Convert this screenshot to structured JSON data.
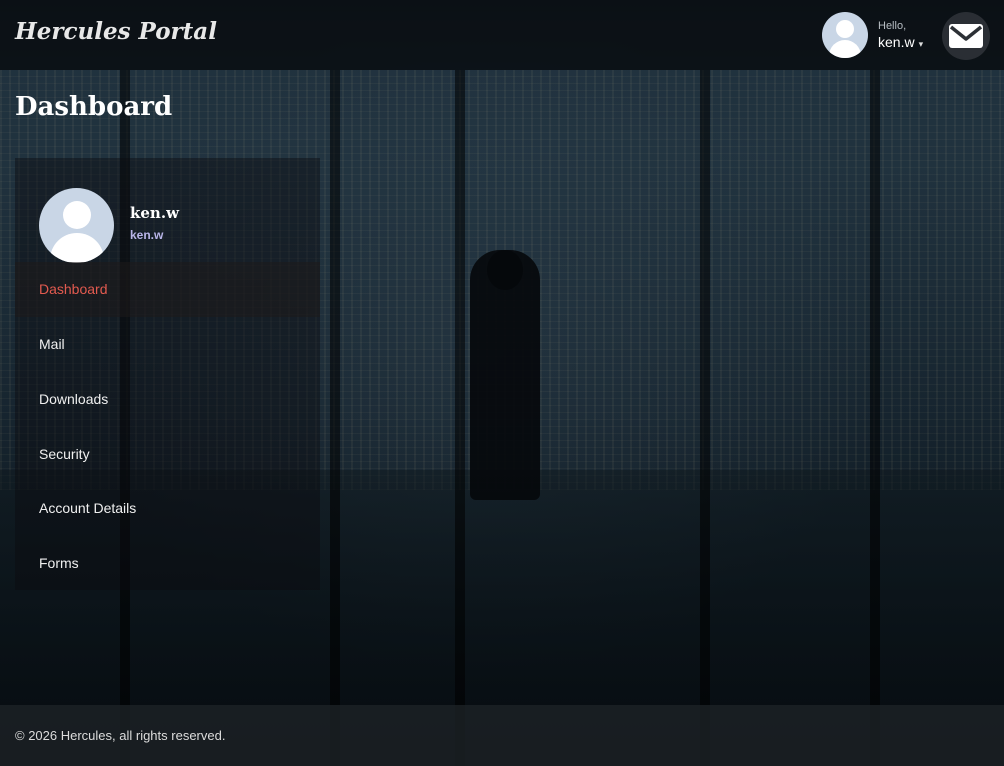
{
  "header": {
    "brand": "Hercules Portal",
    "greeting": "Hello,",
    "username": "ken.w",
    "caret": "▾"
  },
  "page": {
    "title": "Dashboard"
  },
  "profile": {
    "name": "ken.w",
    "handle": "ken.w"
  },
  "sidebar": {
    "items": [
      {
        "label": "Dashboard",
        "active": true
      },
      {
        "label": "Mail",
        "active": false
      },
      {
        "label": "Downloads",
        "active": false
      },
      {
        "label": "Security",
        "active": false
      },
      {
        "label": "Account Details",
        "active": false
      },
      {
        "label": "Forms",
        "active": false
      }
    ]
  },
  "footer": {
    "copyright": "© 2026 Hercules, all rights reserved."
  },
  "colors": {
    "accent": "#e25a4f",
    "handle": "#b9b5e8"
  }
}
